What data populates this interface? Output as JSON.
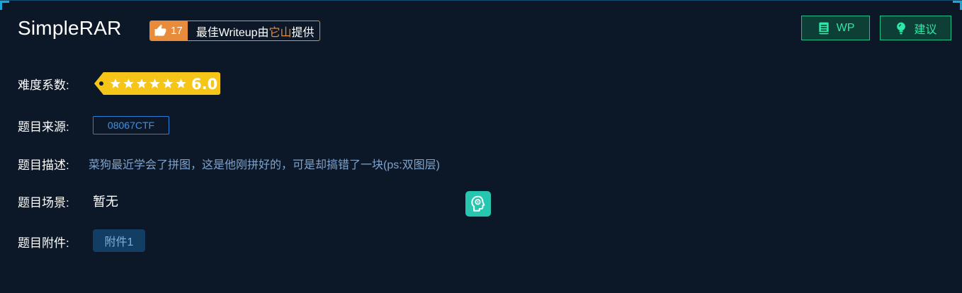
{
  "challenge": {
    "title": "SimpleRAR",
    "writeup_badge": {
      "like_count": "17",
      "text_prefix": "最佳Writeup由",
      "author": "它山",
      "text_suffix": "提供"
    }
  },
  "actions": {
    "wp_label": "WP",
    "suggest_label": "建议"
  },
  "details": {
    "difficulty_label": "难度系数:",
    "difficulty_value": "6.0",
    "difficulty_stars": 6,
    "source_label": "题目来源:",
    "source_value": "08067CTF",
    "description_label": "题目描述:",
    "description_value": "菜狗最近学会了拼图，这是他刚拼好的，可是却搞错了一块(ps:双图层)",
    "scene_label": "题目场景:",
    "scene_value": "暂无",
    "attachment_label": "题目附件:",
    "attachment_value": "附件1"
  },
  "colors": {
    "background": "#0c1827",
    "accent_orange": "#e88b3a",
    "accent_green": "#2ee7a8",
    "difficulty_yellow": "#f5c518",
    "link_blue": "#3b92ec",
    "desc_text": "#7fa2cc",
    "teal_icon": "#26c6b0"
  },
  "icons": {
    "like": "thumbs-up-icon",
    "wp": "document-icon",
    "suggest": "lightbulb-icon",
    "scene_action": "head-gear-icon"
  }
}
